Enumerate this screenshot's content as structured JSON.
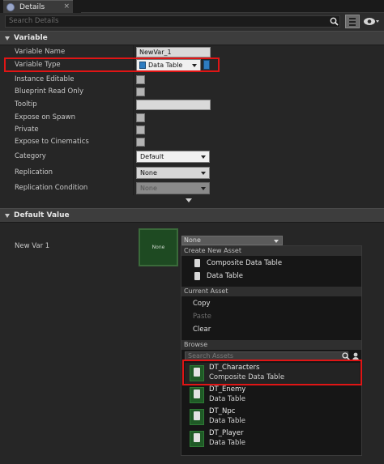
{
  "tab": {
    "title": "Details",
    "close": "×"
  },
  "search": {
    "placeholder": "Search Details"
  },
  "sections": {
    "variable": "Variable",
    "default_value": "Default Value"
  },
  "properties": {
    "variable_name": {
      "label": "Variable Name",
      "value": "NewVar_1"
    },
    "variable_type": {
      "label": "Variable Type",
      "value": "Data Table"
    },
    "instance_editable": {
      "label": "Instance Editable"
    },
    "blueprint_read_only": {
      "label": "Blueprint Read Only"
    },
    "tooltip": {
      "label": "Tooltip",
      "value": ""
    },
    "expose_on_spawn": {
      "label": "Expose on Spawn"
    },
    "private": {
      "label": "Private"
    },
    "expose_to_cinematics": {
      "label": "Expose to Cinematics"
    },
    "category": {
      "label": "Category",
      "value": "Default"
    },
    "replication": {
      "label": "Replication",
      "value": "None"
    },
    "replication_condition": {
      "label": "Replication Condition",
      "value": "None"
    }
  },
  "default_value": {
    "label": "New Var 1",
    "thumbnail_text": "None",
    "combo_value": "None"
  },
  "menu": {
    "create_header": "Create New Asset",
    "create_items": [
      "Composite Data Table",
      "Data Table"
    ],
    "current_header": "Current Asset",
    "current_items": {
      "copy": "Copy",
      "paste": "Paste",
      "clear": "Clear"
    },
    "browse_header": "Browse",
    "browse_search_placeholder": "Search Assets",
    "assets": [
      {
        "name": "DT_Characters",
        "type": "Composite Data Table"
      },
      {
        "name": "DT_Enemy",
        "type": "Data Table"
      },
      {
        "name": "DT_Npc",
        "type": "Data Table"
      },
      {
        "name": "DT_Player",
        "type": "Data Table"
      }
    ]
  },
  "colors": {
    "highlight": "#e01515",
    "asset_green": "#1f5a26",
    "pin_blue": "#2e7cc0"
  }
}
